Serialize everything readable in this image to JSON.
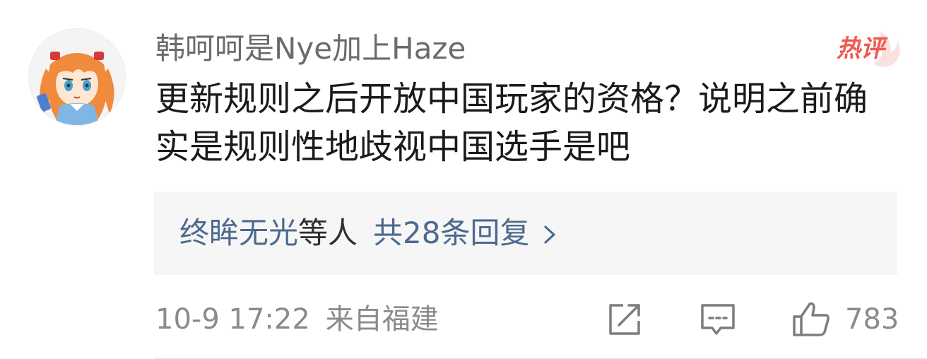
{
  "comment": {
    "username": "韩呵呵是Nye加上Haze",
    "badge": "热评",
    "text": "更新规则之后开放中国玩家的资格？说明之前确实是规则性地歧视中国选手是吧",
    "replies": {
      "users": "终眸无光",
      "others_suffix": "等人",
      "count_label": "共28条回复"
    },
    "timestamp": "10-9 17:22",
    "location": "来自福建",
    "like_count": "783"
  },
  "icons": {
    "avatar": "anime-girl-avatar",
    "repost": "repost-icon",
    "comment": "comment-icon",
    "like": "thumbs-up-icon",
    "chevron": "chevron-right-icon"
  },
  "colors": {
    "username": "#6b6b6b",
    "text": "#1a1a1a",
    "reply_link": "#4c6a8e",
    "meta": "#8b8b8b",
    "hot_badge": "#ee5a52",
    "reply_bg": "#f6f6f6"
  }
}
